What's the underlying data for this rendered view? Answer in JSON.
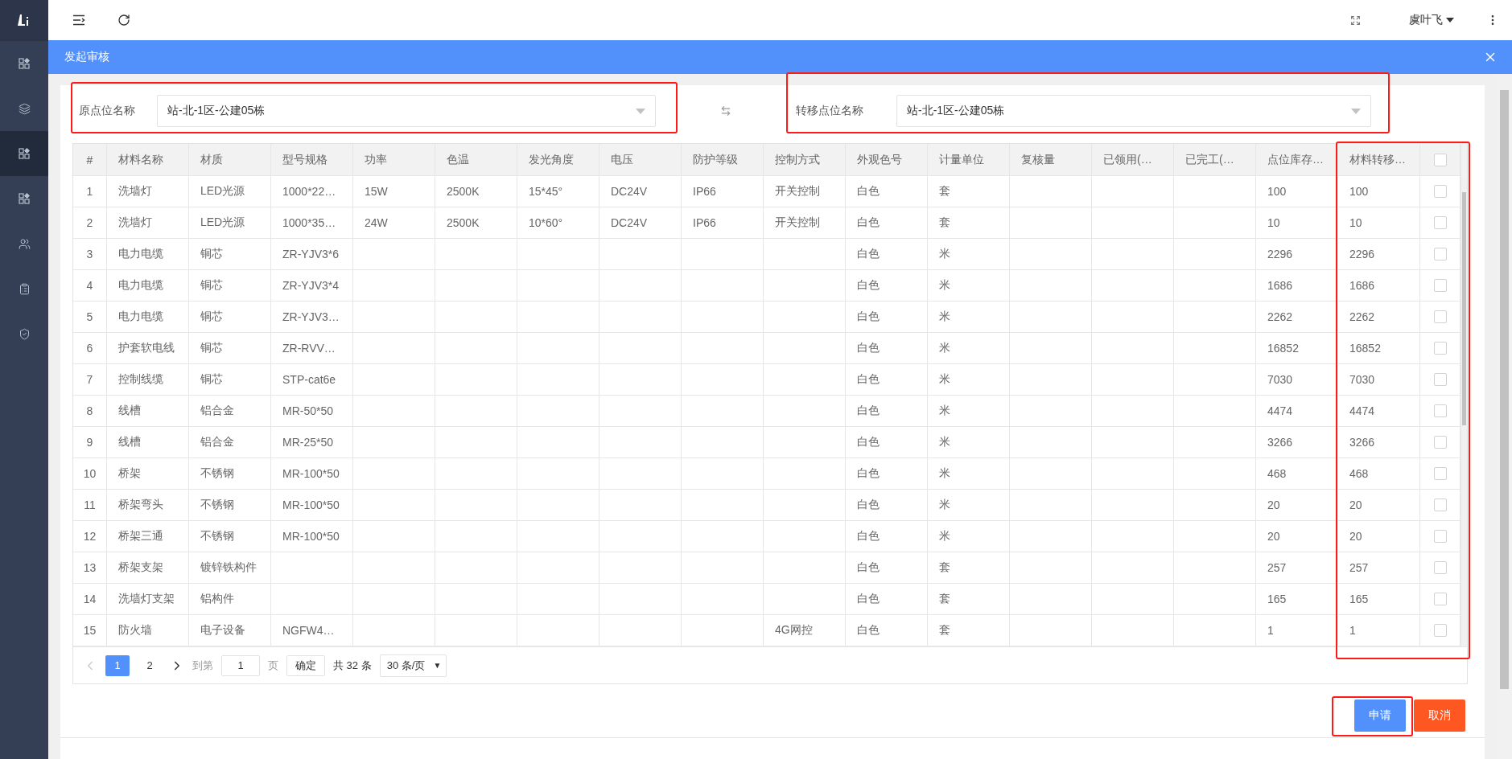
{
  "sidebar": {
    "items": [
      {
        "kind": "grid",
        "selected": false
      },
      {
        "kind": "layers",
        "selected": false
      },
      {
        "kind": "grid",
        "selected": true
      },
      {
        "kind": "grid",
        "selected": false
      },
      {
        "kind": "users",
        "selected": false
      },
      {
        "kind": "clipboard",
        "selected": false
      },
      {
        "kind": "shield",
        "selected": false
      }
    ]
  },
  "topbar": {
    "user": "虞叶飞"
  },
  "dialog": {
    "title": "发起审核"
  },
  "origin": {
    "label": "原点位名称",
    "value": "站-北-1区-公建05栋",
    "highlighted": true
  },
  "destination": {
    "label": "转移点位名称",
    "value": "站-北-1区-公建05栋",
    "highlighted": true
  },
  "table": {
    "columns": [
      {
        "label": "#",
        "highlighted": false
      },
      {
        "label": "材料名称",
        "highlighted": false
      },
      {
        "label": "材质",
        "highlighted": false
      },
      {
        "label": "型号规格",
        "highlighted": false
      },
      {
        "label": "功率",
        "highlighted": false
      },
      {
        "label": "色温",
        "highlighted": false
      },
      {
        "label": "发光角度",
        "highlighted": false
      },
      {
        "label": "电压",
        "highlighted": false
      },
      {
        "label": "防护等级",
        "highlighted": false
      },
      {
        "label": "控制方式",
        "highlighted": false
      },
      {
        "label": "外观色号",
        "highlighted": false
      },
      {
        "label": "计量单位",
        "highlighted": false
      },
      {
        "label": "复核量",
        "highlighted": false
      },
      {
        "label": "已领用(…",
        "highlighted": false
      },
      {
        "label": "已完工(…",
        "highlighted": false
      },
      {
        "label": "点位库存…",
        "highlighted": false
      },
      {
        "label": "材料转移…",
        "highlighted": true
      }
    ],
    "select_all_checked": false,
    "rows": [
      {
        "no": "1",
        "name": "洗墙灯",
        "material": "LED光源",
        "model": "1000*22…",
        "power": "15W",
        "temp": "2500K",
        "angle": "15*45°",
        "voltage": "DC24V",
        "ip": "IP66",
        "control": "开关控制",
        "look": "白色",
        "unit": "套",
        "stock": "100",
        "transfer": "100",
        "checked": false
      },
      {
        "no": "2",
        "name": "洗墙灯",
        "material": "LED光源",
        "model": "1000*35…",
        "power": "24W",
        "temp": "2500K",
        "angle": "10*60°",
        "voltage": "DC24V",
        "ip": "IP66",
        "control": "开关控制",
        "look": "白色",
        "unit": "套",
        "stock": "10",
        "transfer": "10",
        "checked": false
      },
      {
        "no": "3",
        "name": "电力电缆",
        "material": "铜芯",
        "model": "ZR-YJV3*6",
        "look": "白色",
        "unit": "米",
        "stock": "2296",
        "transfer": "2296",
        "checked": false
      },
      {
        "no": "4",
        "name": "电力电缆",
        "material": "铜芯",
        "model": "ZR-YJV3*4",
        "look": "白色",
        "unit": "米",
        "stock": "1686",
        "transfer": "1686",
        "checked": false
      },
      {
        "no": "5",
        "name": "电力电缆",
        "material": "铜芯",
        "model": "ZR-YJV3…",
        "look": "白色",
        "unit": "米",
        "stock": "2262",
        "transfer": "2262",
        "checked": false
      },
      {
        "no": "6",
        "name": "护套软电线",
        "material": "铜芯",
        "model": "ZR-RVV…",
        "look": "白色",
        "unit": "米",
        "stock": "16852",
        "transfer": "16852",
        "checked": false
      },
      {
        "no": "7",
        "name": "控制线缆",
        "material": "铜芯",
        "model": "STP-cat6e",
        "look": "白色",
        "unit": "米",
        "stock": "7030",
        "transfer": "7030",
        "checked": false
      },
      {
        "no": "8",
        "name": "线槽",
        "material": "铝合金",
        "model": "MR-50*50",
        "look": "白色",
        "unit": "米",
        "stock": "4474",
        "transfer": "4474",
        "checked": false
      },
      {
        "no": "9",
        "name": "线槽",
        "material": "铝合金",
        "model": "MR-25*50",
        "look": "白色",
        "unit": "米",
        "stock": "3266",
        "transfer": "3266",
        "checked": false
      },
      {
        "no": "10",
        "name": "桥架",
        "material": "不锈钢",
        "model": "MR-100*50",
        "look": "白色",
        "unit": "米",
        "stock": "468",
        "transfer": "468",
        "checked": false
      },
      {
        "no": "11",
        "name": "桥架弯头",
        "material": "不锈钢",
        "model": "MR-100*50",
        "look": "白色",
        "unit": "米",
        "stock": "20",
        "transfer": "20",
        "checked": false
      },
      {
        "no": "12",
        "name": "桥架三通",
        "material": "不锈钢",
        "model": "MR-100*50",
        "look": "白色",
        "unit": "米",
        "stock": "20",
        "transfer": "20",
        "checked": false
      },
      {
        "no": "13",
        "name": "桥架支架",
        "material": "镀锌铁构件",
        "look": "白色",
        "unit": "套",
        "stock": "257",
        "transfer": "257",
        "checked": false
      },
      {
        "no": "14",
        "name": "洗墙灯支架",
        "material": "铝构件",
        "look": "白色",
        "unit": "套",
        "stock": "165",
        "transfer": "165",
        "checked": false
      },
      {
        "no": "15",
        "name": "防火墙",
        "material": "电子设备",
        "model": "NGFW4…",
        "control": "4G网控",
        "look": "白色",
        "unit": "套",
        "stock": "1",
        "transfer": "1",
        "checked": false
      }
    ]
  },
  "pagination": {
    "pages": [
      {
        "label": "1",
        "selected": true
      },
      {
        "label": "2",
        "selected": false
      }
    ],
    "goto_label": "到第",
    "goto_value": "1",
    "page_unit": "页",
    "confirm": "确定",
    "total": "共 32 条",
    "page_size": "30 条/页",
    "page_size_caret": "▼"
  },
  "actions": {
    "submit": {
      "label": "申请",
      "highlighted": true
    },
    "cancel": {
      "label": "取消"
    }
  }
}
